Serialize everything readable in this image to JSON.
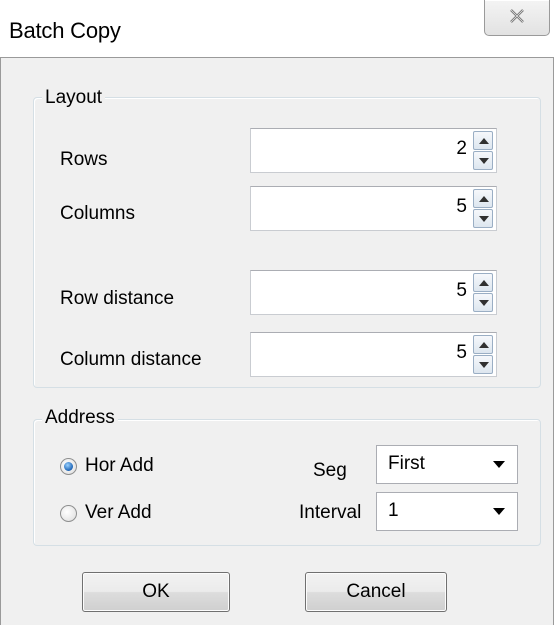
{
  "window": {
    "title": "Batch Copy"
  },
  "layout_group": {
    "legend": "Layout",
    "fields": [
      {
        "label": "Rows",
        "value": "2"
      },
      {
        "label": "Columns",
        "value": "5"
      },
      {
        "label": "Row distance",
        "value": "5"
      },
      {
        "label": "Column distance",
        "value": "5"
      }
    ]
  },
  "address_group": {
    "legend": "Address",
    "radios": [
      {
        "label": "Hor Add",
        "checked": true
      },
      {
        "label": "Ver Add",
        "checked": false
      }
    ],
    "seg": {
      "label": "Seg",
      "value": "First"
    },
    "interval": {
      "label": "Interval",
      "value": "1"
    }
  },
  "buttons": {
    "ok": "OK",
    "cancel": "Cancel"
  },
  "icons": {
    "close": "close-icon",
    "spin_up": "arrow-up-icon",
    "spin_down": "arrow-down-icon",
    "dropdown": "chevron-down-icon"
  }
}
